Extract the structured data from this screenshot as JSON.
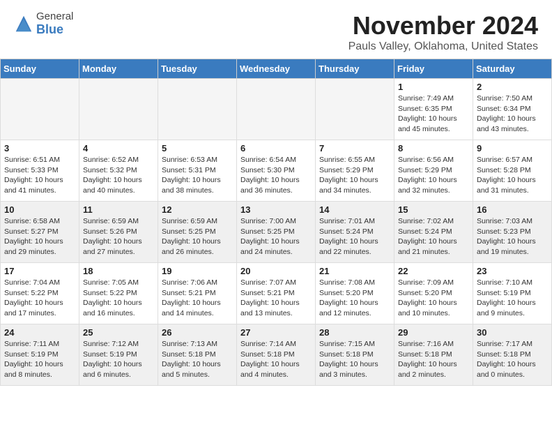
{
  "header": {
    "logo_general": "General",
    "logo_blue": "Blue",
    "title": "November 2024",
    "location": "Pauls Valley, Oklahoma, United States"
  },
  "weekdays": [
    "Sunday",
    "Monday",
    "Tuesday",
    "Wednesday",
    "Thursday",
    "Friday",
    "Saturday"
  ],
  "weeks": [
    [
      {
        "day": "",
        "info": ""
      },
      {
        "day": "",
        "info": ""
      },
      {
        "day": "",
        "info": ""
      },
      {
        "day": "",
        "info": ""
      },
      {
        "day": "",
        "info": ""
      },
      {
        "day": "1",
        "info": "Sunrise: 7:49 AM\nSunset: 6:35 PM\nDaylight: 10 hours and 45 minutes."
      },
      {
        "day": "2",
        "info": "Sunrise: 7:50 AM\nSunset: 6:34 PM\nDaylight: 10 hours and 43 minutes."
      }
    ],
    [
      {
        "day": "3",
        "info": "Sunrise: 6:51 AM\nSunset: 5:33 PM\nDaylight: 10 hours and 41 minutes."
      },
      {
        "day": "4",
        "info": "Sunrise: 6:52 AM\nSunset: 5:32 PM\nDaylight: 10 hours and 40 minutes."
      },
      {
        "day": "5",
        "info": "Sunrise: 6:53 AM\nSunset: 5:31 PM\nDaylight: 10 hours and 38 minutes."
      },
      {
        "day": "6",
        "info": "Sunrise: 6:54 AM\nSunset: 5:30 PM\nDaylight: 10 hours and 36 minutes."
      },
      {
        "day": "7",
        "info": "Sunrise: 6:55 AM\nSunset: 5:29 PM\nDaylight: 10 hours and 34 minutes."
      },
      {
        "day": "8",
        "info": "Sunrise: 6:56 AM\nSunset: 5:29 PM\nDaylight: 10 hours and 32 minutes."
      },
      {
        "day": "9",
        "info": "Sunrise: 6:57 AM\nSunset: 5:28 PM\nDaylight: 10 hours and 31 minutes."
      }
    ],
    [
      {
        "day": "10",
        "info": "Sunrise: 6:58 AM\nSunset: 5:27 PM\nDaylight: 10 hours and 29 minutes."
      },
      {
        "day": "11",
        "info": "Sunrise: 6:59 AM\nSunset: 5:26 PM\nDaylight: 10 hours and 27 minutes."
      },
      {
        "day": "12",
        "info": "Sunrise: 6:59 AM\nSunset: 5:25 PM\nDaylight: 10 hours and 26 minutes."
      },
      {
        "day": "13",
        "info": "Sunrise: 7:00 AM\nSunset: 5:25 PM\nDaylight: 10 hours and 24 minutes."
      },
      {
        "day": "14",
        "info": "Sunrise: 7:01 AM\nSunset: 5:24 PM\nDaylight: 10 hours and 22 minutes."
      },
      {
        "day": "15",
        "info": "Sunrise: 7:02 AM\nSunset: 5:24 PM\nDaylight: 10 hours and 21 minutes."
      },
      {
        "day": "16",
        "info": "Sunrise: 7:03 AM\nSunset: 5:23 PM\nDaylight: 10 hours and 19 minutes."
      }
    ],
    [
      {
        "day": "17",
        "info": "Sunrise: 7:04 AM\nSunset: 5:22 PM\nDaylight: 10 hours and 17 minutes."
      },
      {
        "day": "18",
        "info": "Sunrise: 7:05 AM\nSunset: 5:22 PM\nDaylight: 10 hours and 16 minutes."
      },
      {
        "day": "19",
        "info": "Sunrise: 7:06 AM\nSunset: 5:21 PM\nDaylight: 10 hours and 14 minutes."
      },
      {
        "day": "20",
        "info": "Sunrise: 7:07 AM\nSunset: 5:21 PM\nDaylight: 10 hours and 13 minutes."
      },
      {
        "day": "21",
        "info": "Sunrise: 7:08 AM\nSunset: 5:20 PM\nDaylight: 10 hours and 12 minutes."
      },
      {
        "day": "22",
        "info": "Sunrise: 7:09 AM\nSunset: 5:20 PM\nDaylight: 10 hours and 10 minutes."
      },
      {
        "day": "23",
        "info": "Sunrise: 7:10 AM\nSunset: 5:19 PM\nDaylight: 10 hours and 9 minutes."
      }
    ],
    [
      {
        "day": "24",
        "info": "Sunrise: 7:11 AM\nSunset: 5:19 PM\nDaylight: 10 hours and 8 minutes."
      },
      {
        "day": "25",
        "info": "Sunrise: 7:12 AM\nSunset: 5:19 PM\nDaylight: 10 hours and 6 minutes."
      },
      {
        "day": "26",
        "info": "Sunrise: 7:13 AM\nSunset: 5:18 PM\nDaylight: 10 hours and 5 minutes."
      },
      {
        "day": "27",
        "info": "Sunrise: 7:14 AM\nSunset: 5:18 PM\nDaylight: 10 hours and 4 minutes."
      },
      {
        "day": "28",
        "info": "Sunrise: 7:15 AM\nSunset: 5:18 PM\nDaylight: 10 hours and 3 minutes."
      },
      {
        "day": "29",
        "info": "Sunrise: 7:16 AM\nSunset: 5:18 PM\nDaylight: 10 hours and 2 minutes."
      },
      {
        "day": "30",
        "info": "Sunrise: 7:17 AM\nSunset: 5:18 PM\nDaylight: 10 hours and 0 minutes."
      }
    ]
  ]
}
